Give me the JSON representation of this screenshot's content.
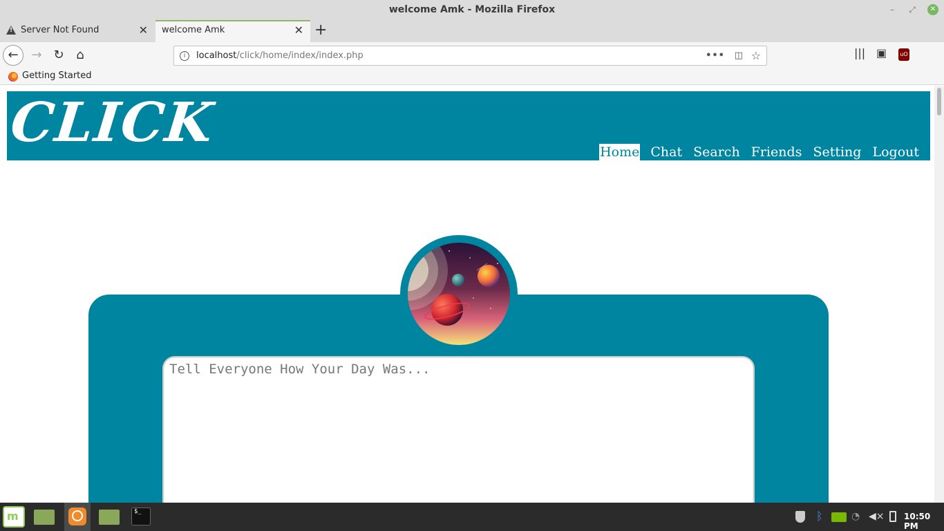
{
  "window": {
    "title": "welcome Amk - Mozilla Firefox"
  },
  "tabs": [
    {
      "label": "Server Not Found",
      "active": false
    },
    {
      "label": "welcome Amk",
      "active": true
    }
  ],
  "navbar": {
    "url_host": "localhost",
    "url_path": "/click/home/index/index.php",
    "page_actions": "•••"
  },
  "bookmarks": [
    {
      "label": "Getting Started"
    }
  ],
  "site": {
    "logo": "CLICK",
    "menu": [
      {
        "label": "Home",
        "active": true
      },
      {
        "label": "Chat",
        "active": false
      },
      {
        "label": "Search",
        "active": false
      },
      {
        "label": "Friends",
        "active": false
      },
      {
        "label": "Setting",
        "active": false
      },
      {
        "label": "Logout",
        "active": false
      }
    ],
    "post_placeholder": "Tell Everyone How Your Day Was...",
    "accent_color": "#0085a1"
  },
  "taskbar": {
    "clock": "10:50 PM",
    "apps": [
      "mint-menu-icon",
      "files-icon",
      "firefox-icon",
      "files-icon",
      "terminal-icon"
    ],
    "terminal_glyph": "$_",
    "mint_glyph": "m"
  }
}
